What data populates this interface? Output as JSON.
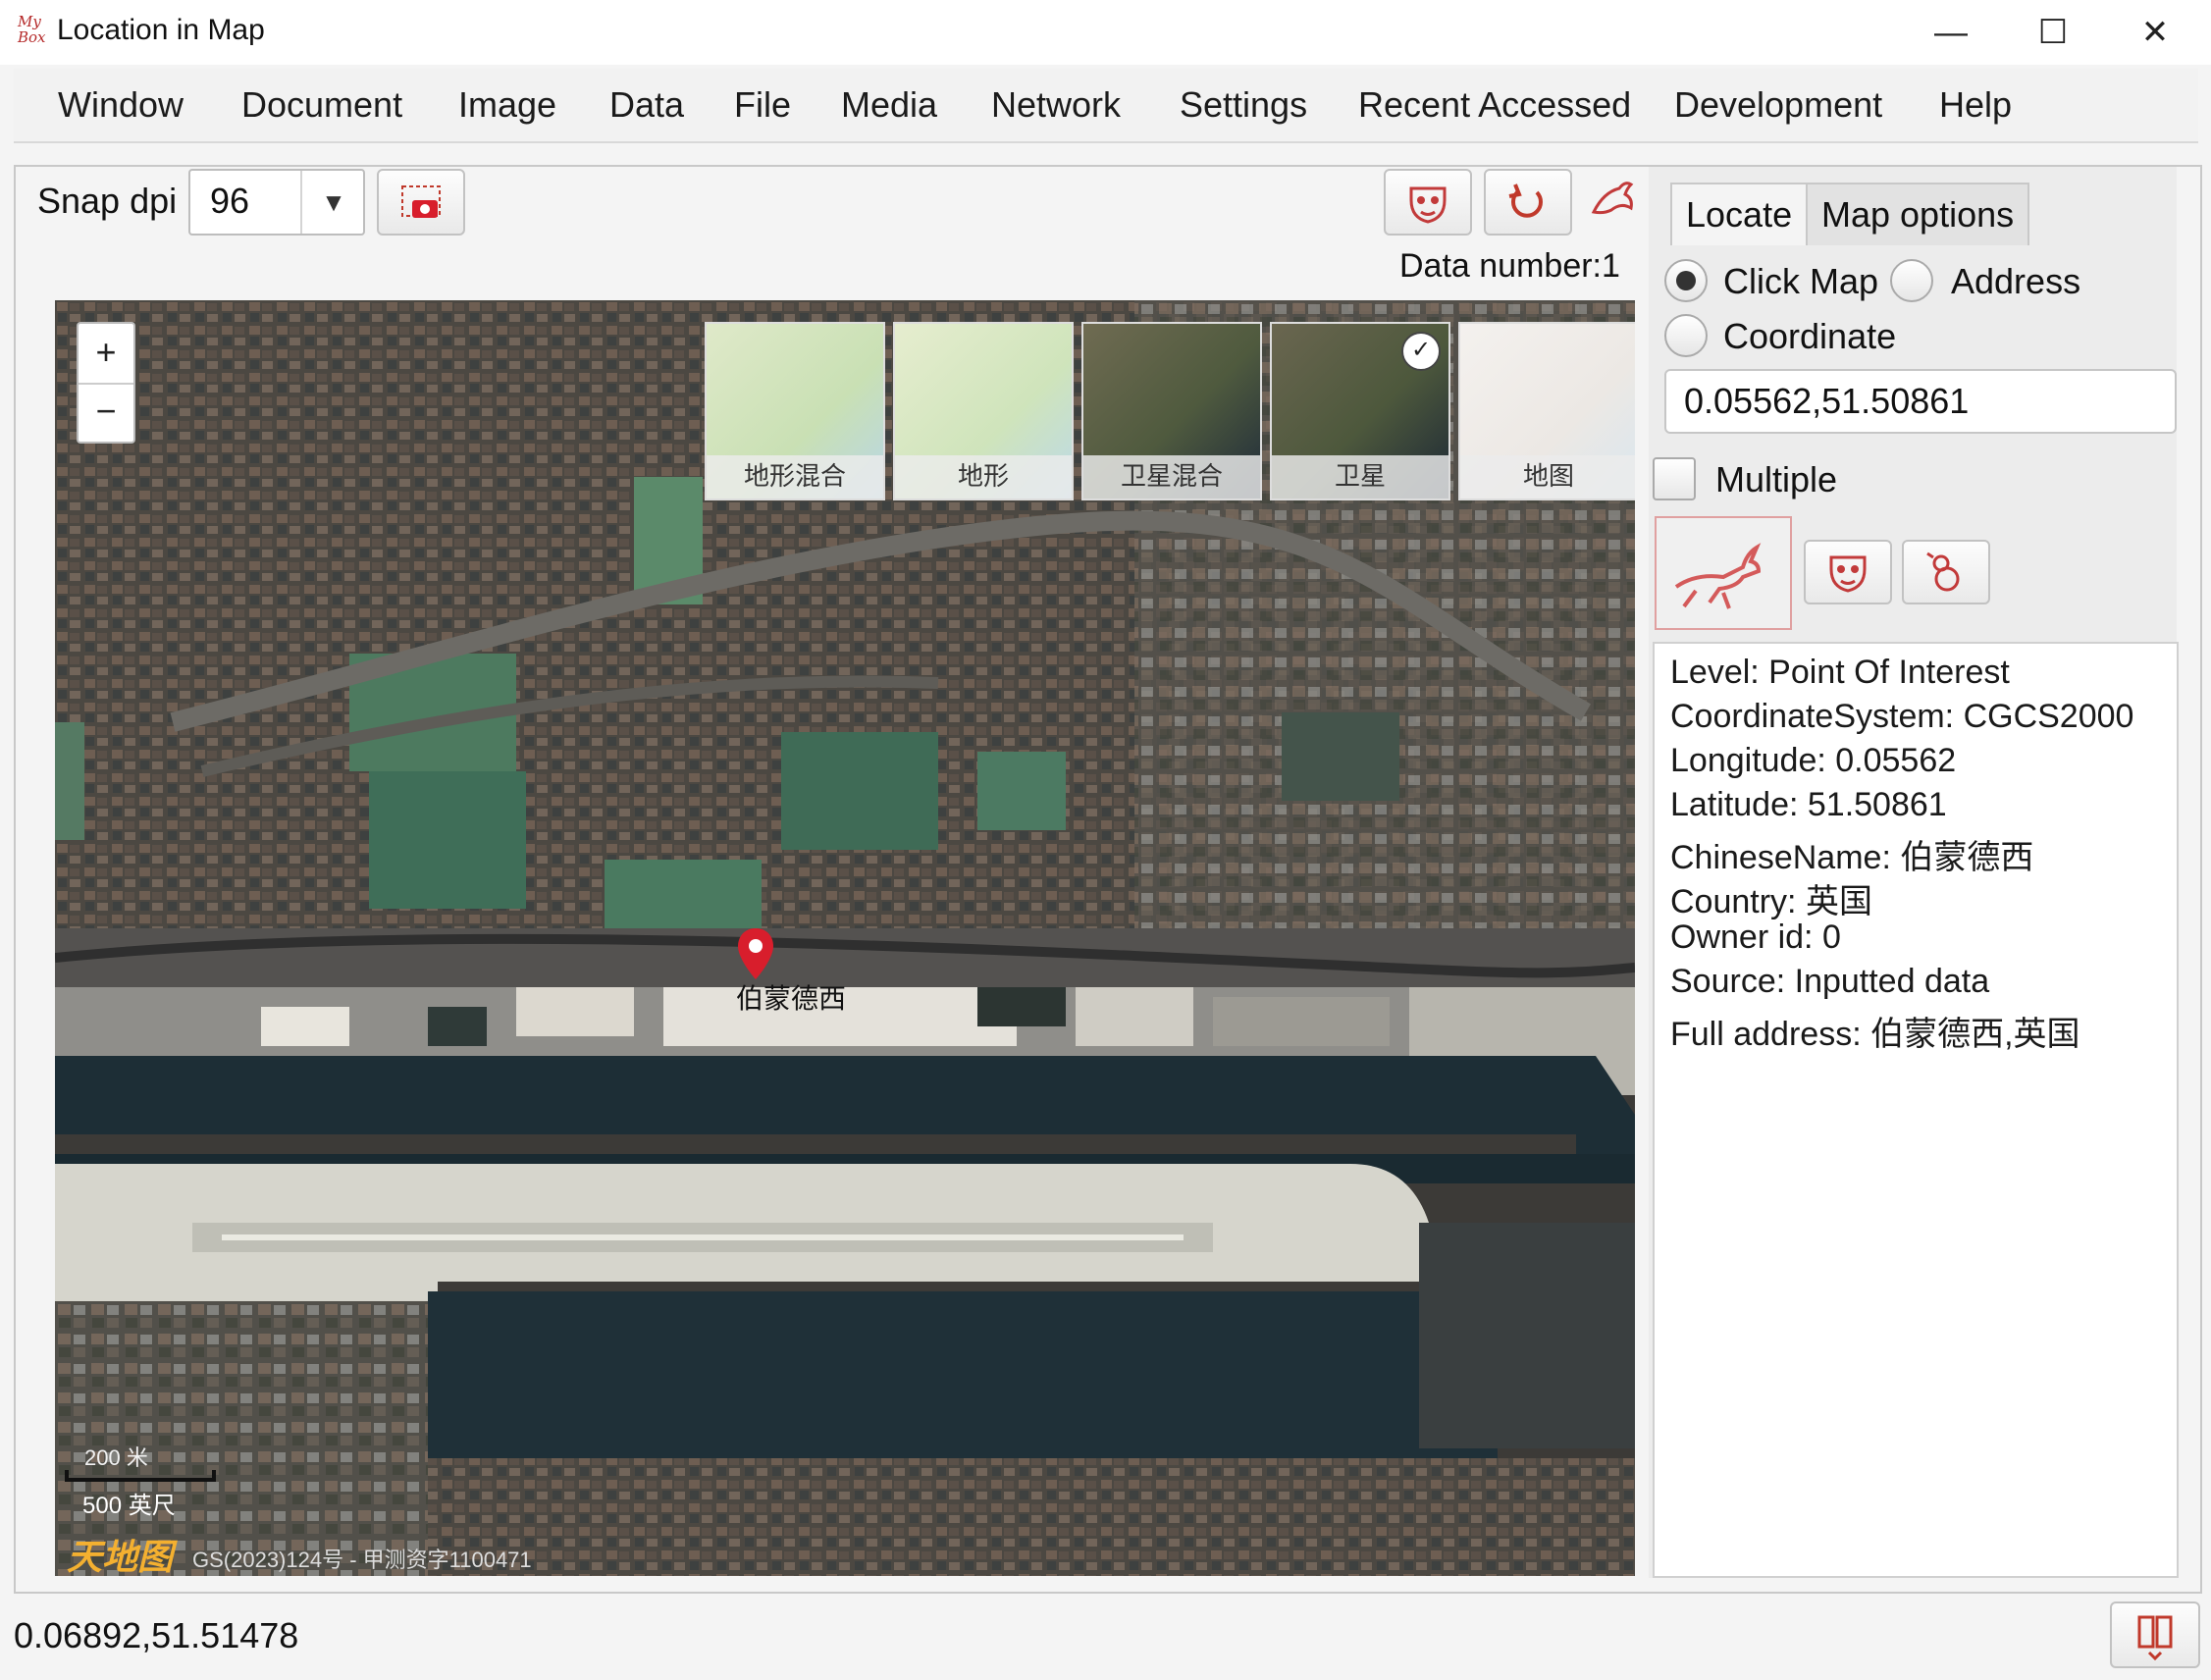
{
  "window": {
    "title": "Location in Map",
    "logo_text": "My Box",
    "controls": {
      "minimize": "—",
      "maximize": "☐",
      "close": "✕"
    }
  },
  "menu": [
    "Window",
    "Document",
    "Image",
    "Data",
    "File",
    "Media",
    "Network",
    "Settings",
    "Recent Accessed",
    "Development",
    "Help"
  ],
  "toolbar": {
    "snap_label": "Snap dpi",
    "dpi_value": "96",
    "data_number": "Data number:1"
  },
  "map": {
    "zoom_in": "+",
    "zoom_out": "−",
    "layers": [
      {
        "label": "地形混合",
        "selected": false
      },
      {
        "label": "地形",
        "selected": false
      },
      {
        "label": "卫星混合",
        "selected": false
      },
      {
        "label": "卫星",
        "selected": true
      },
      {
        "label": "地图",
        "selected": false
      }
    ],
    "selected_mark": "✓",
    "marker_label": "伯蒙德西",
    "scale_meters": "200 米",
    "scale_feet": "500 英尺",
    "provider_logo": "天地图",
    "credit": "GS(2023)124号 - 甲测资字1100471"
  },
  "panel": {
    "tabs": [
      "Locate",
      "Map options"
    ],
    "radio_options": [
      {
        "label": "Click Map",
        "checked": true
      },
      {
        "label": "Address",
        "checked": false
      },
      {
        "label": "Coordinate",
        "checked": false
      }
    ],
    "coordinate_value": "0.05562,51.50861",
    "multiple_label": "Multiple",
    "info_lines": [
      "Level: Point Of Interest",
      "CoordinateSystem: CGCS2000",
      "Longitude: 0.05562",
      "Latitude: 51.50861",
      "ChineseName: 伯蒙德西",
      "Country: 英国",
      "Owner id: 0",
      "Source: Inputted data",
      "Full address: 伯蒙德西,英国"
    ]
  },
  "status": {
    "coordinates": "0.06892,51.51478"
  },
  "colors": {
    "accent_red": "#c0392b",
    "marker_red": "#d81e2c",
    "icon_red": "#c23a3a"
  }
}
